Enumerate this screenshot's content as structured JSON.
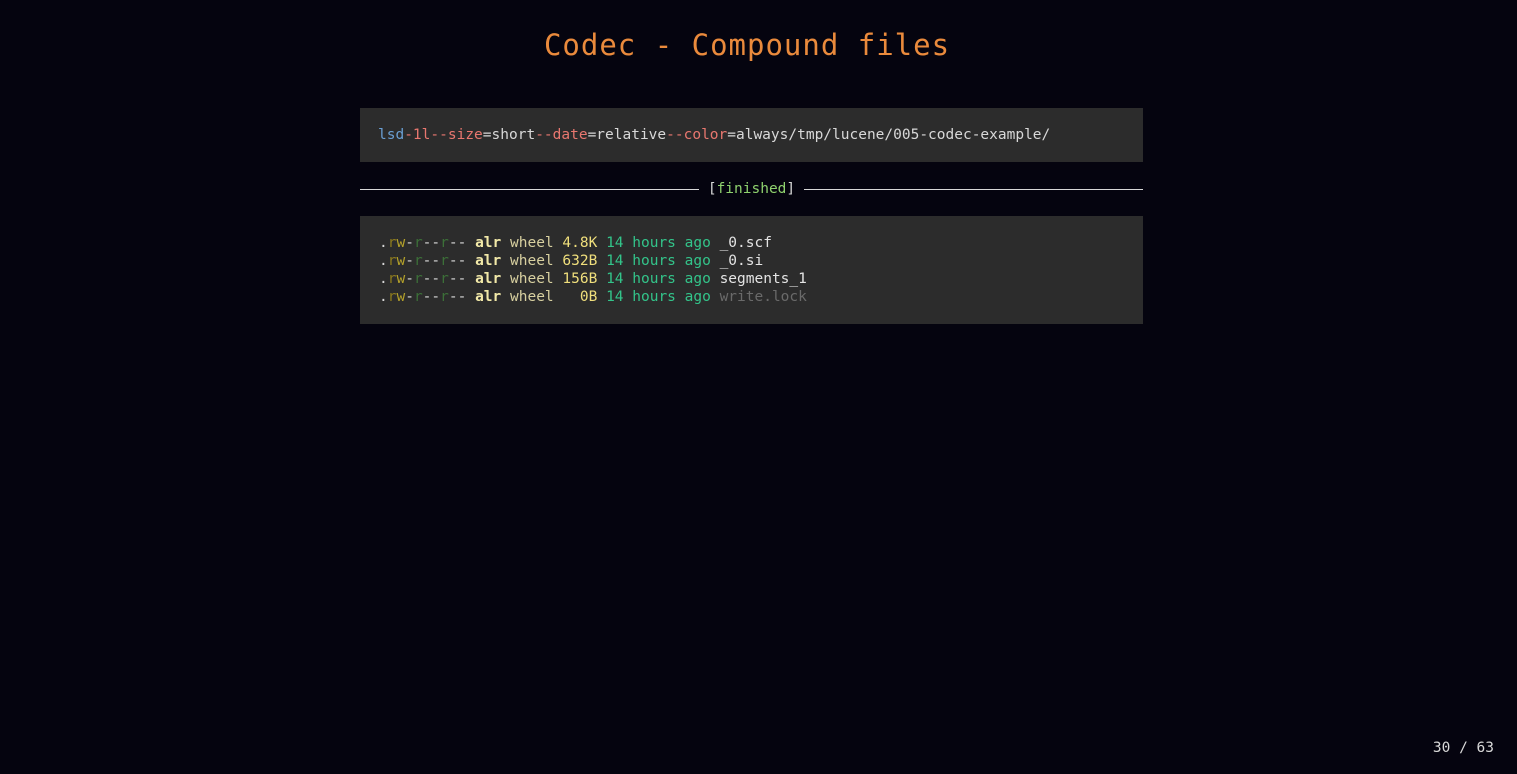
{
  "title": "Codec - Compound files",
  "command": {
    "cmd": "lsd",
    "flag1": "-1l",
    "flag2": "--size",
    "val2": "=short",
    "flag3": "--date",
    "val3": "=relative",
    "flag4": "--color",
    "val4": "=always",
    "path": "/tmp/lucene/005-codec-example/"
  },
  "status": {
    "open": "[",
    "text": "finished",
    "close": "]"
  },
  "files": [
    {
      "perm_dot": ".",
      "perm_r": "r",
      "perm_w": "w",
      "perm_x": "-",
      "perm_gr": "r",
      "perm_gdash": "--",
      "perm_or": "r",
      "perm_odash": "--",
      "user": "alr",
      "group": "wheel",
      "size": "4.8K",
      "date": "14 hours ago",
      "name": "_0.scf"
    },
    {
      "perm_dot": ".",
      "perm_r": "r",
      "perm_w": "w",
      "perm_x": "-",
      "perm_gr": "r",
      "perm_gdash": "--",
      "perm_or": "r",
      "perm_odash": "--",
      "user": "alr",
      "group": "wheel",
      "size": "632B",
      "date": "14 hours ago",
      "name": "_0.si"
    },
    {
      "perm_dot": ".",
      "perm_r": "r",
      "perm_w": "w",
      "perm_x": "-",
      "perm_gr": "r",
      "perm_gdash": "--",
      "perm_or": "r",
      "perm_odash": "--",
      "user": "alr",
      "group": "wheel",
      "size": "156B",
      "date": "14 hours ago",
      "name": "segments_1"
    },
    {
      "perm_dot": ".",
      "perm_r": "r",
      "perm_w": "w",
      "perm_x": "-",
      "perm_gr": "r",
      "perm_gdash": "--",
      "perm_or": "r",
      "perm_odash": "--",
      "user": "alr",
      "group": "wheel",
      "size": "  0B",
      "date": "14 hours ago",
      "name": "write.lock"
    }
  ],
  "pagination": "30 / 63",
  "colors": {
    "background": "#05040f",
    "title": "#ea8a3c",
    "code_background": "#2c2c2c",
    "status_green": "#8fd26e",
    "date_green": "#33c48a"
  }
}
